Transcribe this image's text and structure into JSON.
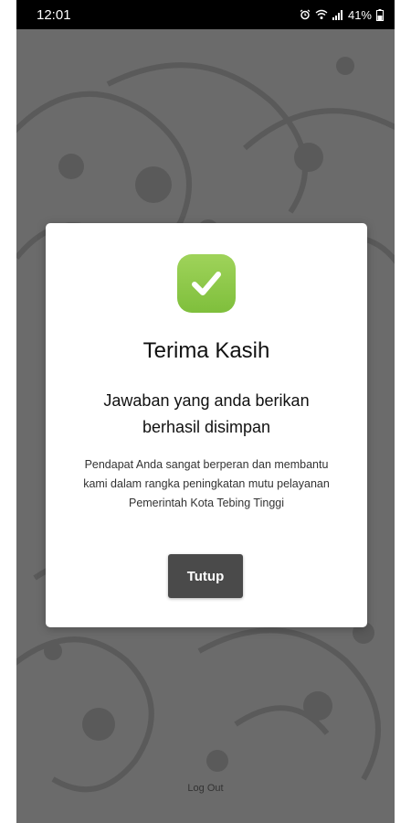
{
  "status_bar": {
    "time": "12:01",
    "battery": "41%",
    "icons": [
      "alarm-icon",
      "wifi-icon",
      "signal-icon",
      "battery-icon"
    ]
  },
  "dialog": {
    "icon": "check-icon",
    "title": "Terima Kasih",
    "subtitle": "Jawaban yang anda berikan berhasil disimpan",
    "message": "Pendapat Anda sangat berperan dan membantu kami dalam rangka peningkatan mutu pelayanan Pemerintah Kota Tebing Tinggi",
    "close_label": "Tutup",
    "accent_color": "#8cc84b",
    "button_color": "#4a4a4a"
  },
  "footer": {
    "logout_label": "Log Out"
  }
}
